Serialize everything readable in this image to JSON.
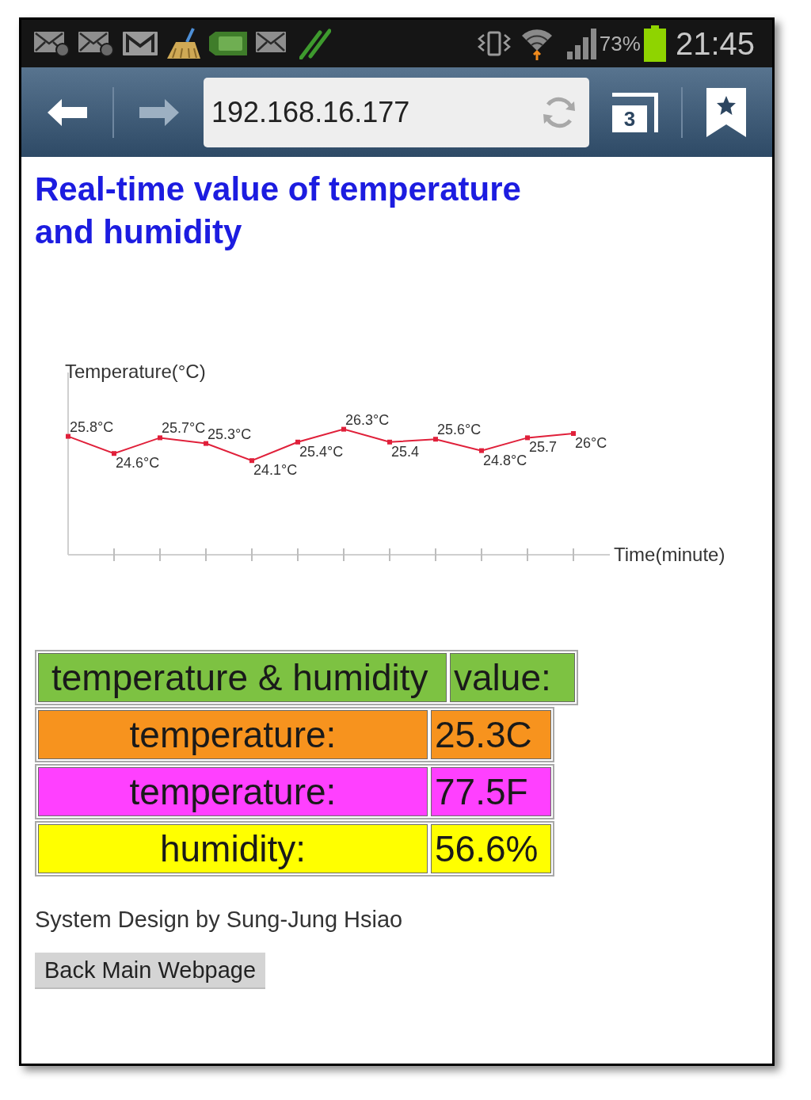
{
  "status_bar": {
    "battery_percent": "73%",
    "time": "21:45"
  },
  "toolbar": {
    "back": {
      "disabled": false
    },
    "forward": {
      "disabled": true
    },
    "address": "192.168.16.177",
    "tab_count": "3"
  },
  "page": {
    "title": "Real-time value of temperature and humidity",
    "chart": {
      "chart_data": {
        "type": "line",
        "ylabel": "Temperature(°C)",
        "xlabel": "Time(minute)",
        "series": [
          {
            "color": "#e0203a",
            "marker": "square",
            "values": [
              25.8,
              24.6,
              25.7,
              25.3,
              24.1,
              25.4,
              26.3,
              25.4,
              25.6,
              24.8,
              25.7,
              26
            ]
          }
        ],
        "data_labels": true,
        "annotations": [
          "°C",
          "°C",
          "°C",
          "°C",
          "°C",
          "°C",
          "°C",
          null,
          "°C",
          "°C",
          null,
          "°C"
        ]
      }
    },
    "table": {
      "rows": [
        {
          "kind": "header",
          "label": "temperature & humidity",
          "value": "value:",
          "color": "#7dc242"
        },
        {
          "kind": "data",
          "label": "temperature:",
          "value": "25.3C",
          "color": "#f7931e"
        },
        {
          "kind": "data",
          "label": "temperature:",
          "value": "77.5F",
          "color": "#ff40ff"
        },
        {
          "kind": "data",
          "label": "humidity:",
          "value": "56.6%",
          "color": "#ffff00"
        }
      ]
    },
    "credit": "System Design by Sung-Jung Hsiao",
    "back_button": "Back Main Webpage"
  }
}
